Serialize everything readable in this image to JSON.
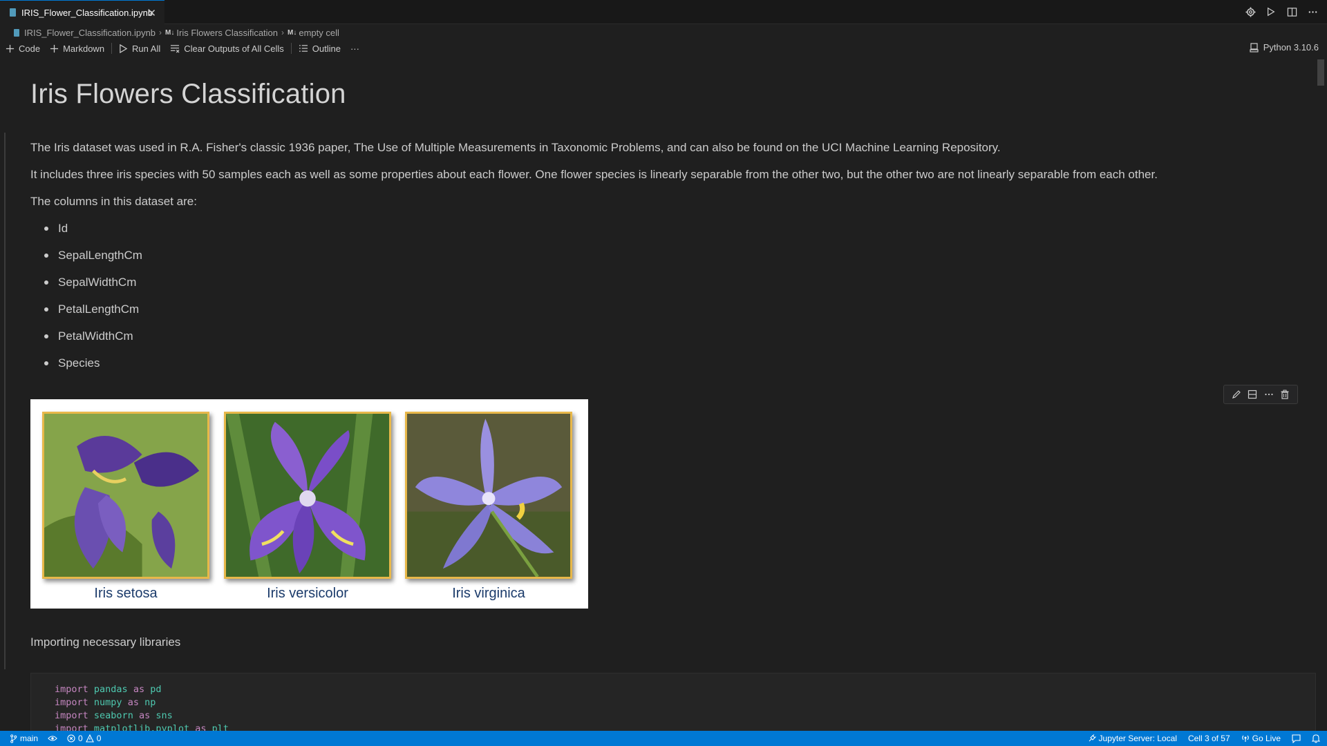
{
  "tab": {
    "filename": "IRIS_Flower_Classification.ipynb",
    "close_glyph": "✕"
  },
  "breadcrumb": {
    "file": "IRIS_Flower_Classification.ipynb",
    "section": "Iris Flowers Classification",
    "cell": "empty cell",
    "md_badge": "M↓"
  },
  "toolbar": {
    "code_label": "Code",
    "markdown_label": "Markdown",
    "run_all_label": "Run All",
    "clear_outputs_label": "Clear Outputs of All Cells",
    "outline_label": "Outline",
    "more_glyph": "···",
    "kernel_label": "Python 3.10.6"
  },
  "notebook": {
    "title": "Iris Flowers Classification",
    "paragraphs": [
      "The Iris dataset was used in R.A. Fisher's classic 1936 paper, The Use of Multiple Measurements in Taxonomic Problems, and can also be found on the UCI Machine Learning Repository.",
      "It includes three iris species with 50 samples each as well as some properties about each flower. One flower species is linearly separable from the other two, but the other two are not linearly separable from each other.",
      "The columns in this dataset are:"
    ],
    "columns": [
      "Id",
      "SepalLengthCm",
      "SepalWidthCm",
      "PetalLengthCm",
      "PetalWidthCm",
      "Species"
    ],
    "species_labels": [
      "Iris setosa",
      "Iris versicolor",
      "Iris virginica"
    ],
    "section_heading": "Importing necessary libraries",
    "code_lines": [
      {
        "kw": "import",
        "mod": "pandas",
        "as": "as",
        "alias": "pd"
      },
      {
        "kw": "import",
        "mod": "numpy",
        "as": "as",
        "alias": "np"
      },
      {
        "kw": "import",
        "mod": "seaborn",
        "as": "as",
        "alias": "sns"
      },
      {
        "kw": "import",
        "mod": "matplotlib.pyplot",
        "as": "as",
        "alias": "plt"
      }
    ]
  },
  "statusbar": {
    "branch": "main",
    "errors": "0",
    "warnings": "0",
    "jupyter_server": "Jupyter Server: Local",
    "cell_position": "Cell 3 of 57",
    "go_live": "Go Live"
  },
  "colors": {
    "accent": "#0078d4",
    "keyword": "#c586c0",
    "module": "#4ec9b0",
    "photo_border": "#e8b84a"
  }
}
